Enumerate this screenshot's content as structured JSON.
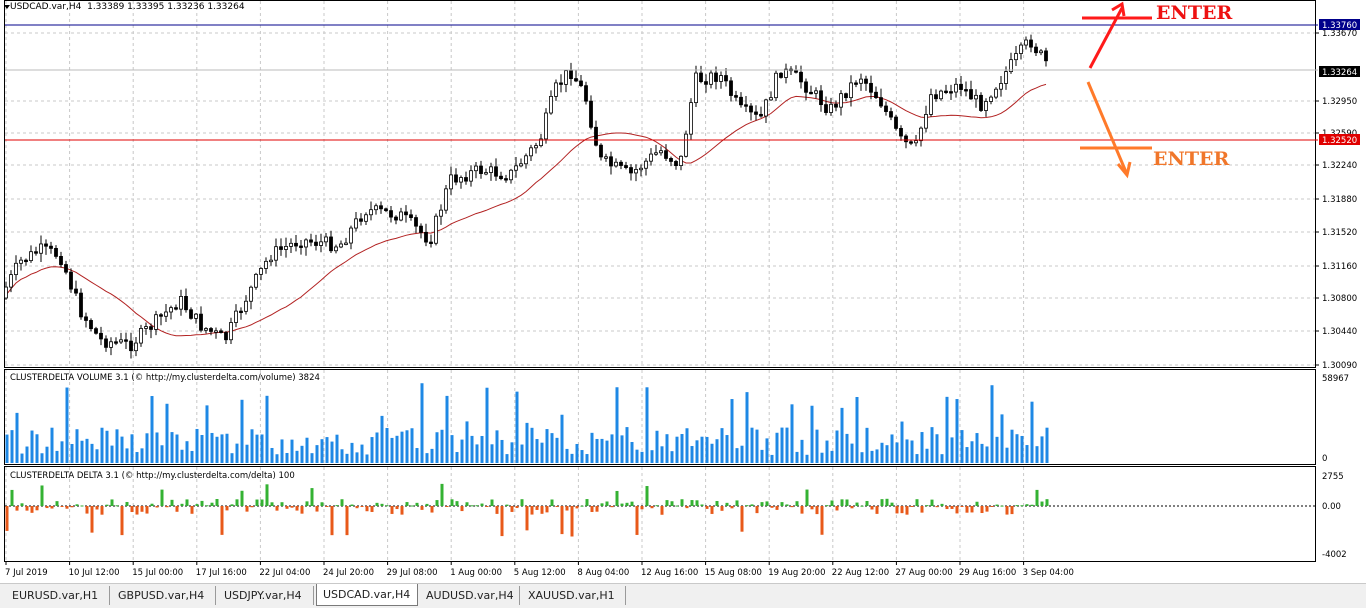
{
  "chart": {
    "symbol_menu_icon": "triangle-down-icon",
    "title": "USDCAD.var,H4",
    "ohlc": "1.33389 1.33395 1.33236 1.33264",
    "price_ticks": [
      "1.33670",
      "1.32950",
      "1.32590",
      "1.32240",
      "1.31880",
      "1.31520",
      "1.31160",
      "1.30800",
      "1.30440",
      "1.30090"
    ],
    "price_tags": {
      "upper_line": "1.33760",
      "current": "1.33264",
      "lower_line": "1.32520"
    },
    "colors": {
      "upper_line": "#00008b",
      "lower_line": "#e00000",
      "current_tag": "#000000",
      "ma_line": "#b22222",
      "candle": "#000000",
      "volume_bar": "#1e88e5",
      "delta_positive": "#34b233",
      "delta_negative": "#e8591a",
      "enter_up": "#ff1a1a",
      "enter_down": "#ff7a2a"
    },
    "annotations": {
      "enter_up": "ENTER",
      "enter_down": "ENTER"
    },
    "date_labels": [
      "7 Jul 2019",
      "10 Jul 12:00",
      "15 Jul 00:00",
      "17 Jul 16:00",
      "22 Jul 04:00",
      "24 Jul 20:00",
      "29 Jul 08:00",
      "1 Aug 00:00",
      "5 Aug 12:00",
      "8 Aug 04:00",
      "12 Aug 16:00",
      "15 Aug 08:00",
      "19 Aug 20:00",
      "22 Aug 12:00",
      "27 Aug 00:00",
      "29 Aug 16:00",
      "3 Sep 04:00"
    ]
  },
  "volume_panel": {
    "title": "CLUSTERDELTA VOLUME 3.1 (© http://my.clusterdelta.com/volume) 3824",
    "ticks": [
      "58967",
      "0"
    ]
  },
  "delta_panel": {
    "title": "CLUSTERDELTA DELTA 3.1 (© http://my.clusterdelta.com/delta) 100",
    "ticks": [
      "2755",
      "0.00",
      "-4002"
    ]
  },
  "tabs": [
    {
      "label": "EURUSD.var,H1",
      "active": false
    },
    {
      "label": "GBPUSD.var,H4",
      "active": false
    },
    {
      "label": "USDJPY.var,H4",
      "active": false
    },
    {
      "label": "USDCAD.var,H4",
      "active": true
    },
    {
      "label": "AUDUSD.var,H4",
      "active": false
    },
    {
      "label": "XAUUSD.var,H1",
      "active": false
    }
  ]
}
